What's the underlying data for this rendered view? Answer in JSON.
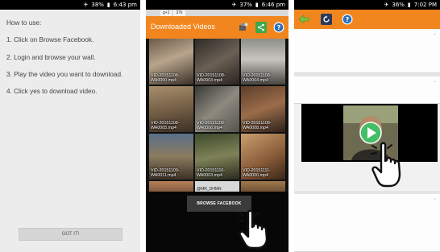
{
  "phone1": {
    "status": {
      "battery": "38%",
      "time": "6:43 pm"
    },
    "instructions": [
      "How to use:",
      "1. Click on Browse Facebook.",
      "2. Login and browse your wall.",
      "3. Play the video you want to download.",
      "4. Click yes to download video."
    ],
    "got_it_label": "GOT IT!"
  },
  "phone2": {
    "status": {
      "battery": "37%",
      "time": "6:46 pm"
    },
    "tabs": [
      "g+1",
      "37k"
    ],
    "title": "Downloaded Videos",
    "icons": [
      "video-edit-icon",
      "share-icon",
      "help-icon"
    ],
    "videos": [
      {
        "name": "VID-20151108-WA0000.mp4"
      },
      {
        "name": "VID-20151108-WA0003.mp4"
      },
      {
        "name": "VID-20151108-WA0004.mp4"
      },
      {
        "name": "VID-20151108-WA0005.mp4"
      },
      {
        "name": "VID-20151108-WA0006.mp4"
      },
      {
        "name": "VID-20151108-WA0008.mp4"
      },
      {
        "name": "VID-20151109-WA0011.mp4"
      },
      {
        "name": "VID-20151110-WA0003.mp4"
      },
      {
        "name": "VID-20151111-WA0000.mp4"
      }
    ],
    "watermark": "@MR_DHMN",
    "browse_label": "BROWSE FACEBOOK"
  },
  "phone3": {
    "status": {
      "battery": "36%",
      "time": "7:02 PM"
    },
    "icons": [
      "back-arrow-icon",
      "refresh-icon",
      "help-icon"
    ]
  },
  "colors": {
    "accent": "#f2861e",
    "status_bar": "#000000"
  }
}
